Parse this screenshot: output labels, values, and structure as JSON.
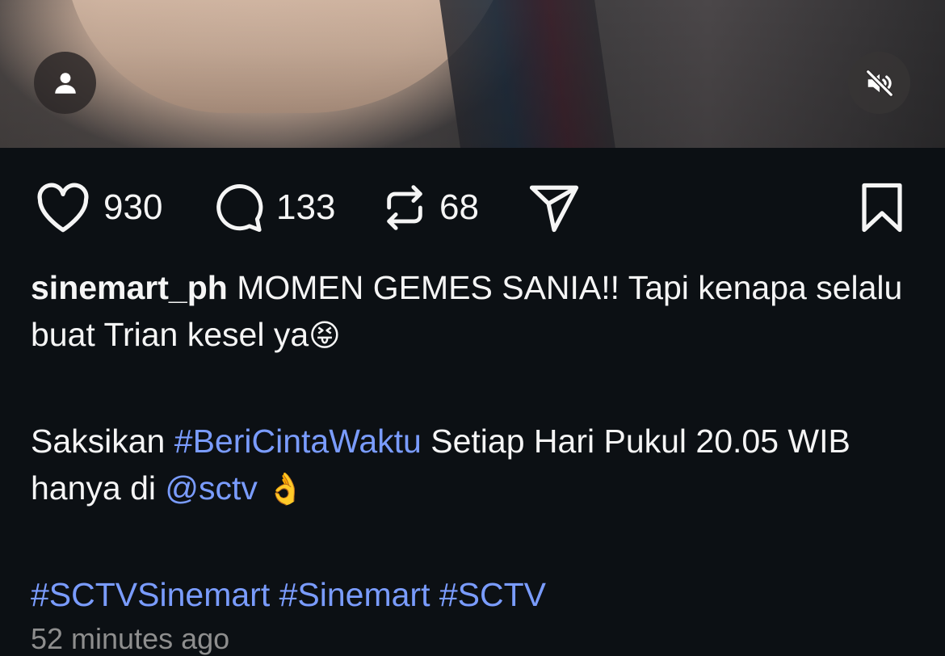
{
  "post": {
    "username": "sinemart_ph",
    "caption_line1": " MOMEN GEMES SANIA!! Tapi kenapa selalu buat Trian kesel ya",
    "caption_emoji1": "😝",
    "line2_prefix": "Saksikan ",
    "line2_hashtag": "#BeriCintaWaktu",
    "line2_middle": " Setiap Hari Pukul 20.05 WIB hanya di ",
    "line2_mention": "@sctv",
    "line2_emoji": " 👌",
    "hashtags": "#SCTVSinemart #Sinemart #SCTV",
    "timestamp": "52 minutes ago"
  },
  "actions": {
    "likes": "930",
    "comments": "133",
    "reposts": "68"
  },
  "icons": {
    "video_user": "user-icon",
    "video_mute": "mute-icon",
    "like": "heart-icon",
    "comment": "comment-icon",
    "repost": "repost-icon",
    "share": "send-icon",
    "save": "bookmark-icon"
  },
  "colors": {
    "background": "#0c1014",
    "link": "#7a9cff",
    "text": "#f5f5f5",
    "muted": "#8e8e8e"
  }
}
